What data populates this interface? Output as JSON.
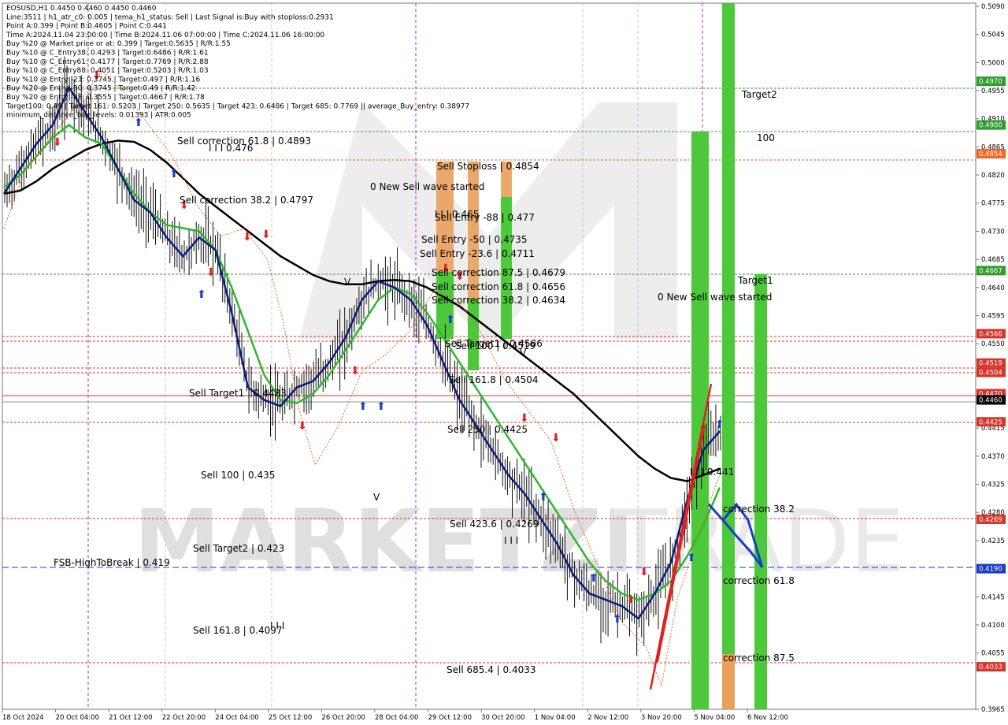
{
  "header": {
    "lines": [
      "EOSUSD,H1  0.4450 0.4460 0.4450 0.4460",
      "Line:3511  | h1_atr_c0: 0.005  | tema_h1_status: Sell  | Last Signal is:Buy with stoploss:0.2931",
      "Point A:0.399  | Point B:0.4605  | Point C:0.441",
      "Time A:2024.11.04 23:00:00  | Time B:2024.11.06 07:00:00  | Time C:2024.11.06 16:00:00",
      "Buy %20 @ Market price or at: 0.399  | Target:0.5635  | R/R:1.55",
      "Buy %10 @ C_Entry38: 0.4293  | Target:0.6486  | R/R:1.61",
      "Buy %10 @ C_Entry61: 0.4177  | Target:0.7769  | R/R:2.88",
      "Buy %10 @ C_Entry88: 0.4051  | Target:0.5203  | R/R:1.03",
      "Buy %10 @ Entry -23: 0.3745  | Target:0.497  | R/R:1.16",
      "Buy %20 @ Entry -50: 0.3745  | Target:0.49  | R/R:1.42",
      "Buy %20 @ Entry -88: 0.3555  | Target:0.4667  | R/R:1.78",
      "Target100: 0.49  | Target 161: 0.5203  | Target 250: 0.5635  | Target 423: 0.6486  | Target 685: 0.7769  || average_Buy_entry: 0.38977",
      "minimum_distance_buy_levels: 0.01393  | ATR:0.005"
    ]
  },
  "watermark": {
    "left": "MARKETZI",
    "right": "TRADE"
  },
  "price_tags": [
    {
      "label": "0.4970",
      "price": 0.497,
      "color": "#2e9d2e"
    },
    {
      "label": "0.4900",
      "price": 0.49,
      "color": "#2e9d2e"
    },
    {
      "label": "0.4854",
      "price": 0.4854,
      "color": "#f26522"
    },
    {
      "label": "0.4667",
      "price": 0.4667,
      "color": "#2e9d2e"
    },
    {
      "label": "0.4566",
      "price": 0.4566,
      "color": "#d9342b"
    },
    {
      "label": "0.4519",
      "price": 0.4519,
      "color": "#d9342b"
    },
    {
      "label": "0.4504",
      "price": 0.4504,
      "color": "#d9342b"
    },
    {
      "label": "0.4470",
      "price": 0.447,
      "color": "#d9342b"
    },
    {
      "label": "0.4460",
      "price": 0.446,
      "color": "#000000"
    },
    {
      "label": "0.4425",
      "price": 0.4425,
      "color": "#d9342b"
    },
    {
      "label": "0.4269",
      "price": 0.4269,
      "color": "#d9342b"
    },
    {
      "label": "0.4190",
      "price": 0.419,
      "color": "#1a3cc8"
    },
    {
      "label": "0.4033",
      "price": 0.4033,
      "color": "#d9342b"
    }
  ],
  "annotations": [
    {
      "text": "Sell correction 61.8 | 0.4893",
      "color": "#1f3f8a"
    },
    {
      "text": "I I I  0.476",
      "color": "#1f3f8a"
    },
    {
      "text": "Sell correction 38.2 | 0.4797",
      "color": "#1f3f8a"
    },
    {
      "text": "0 New Sell wave started",
      "color": "#000000"
    },
    {
      "text": "Sell Stoploss | 0.4854",
      "color": "#f26522"
    },
    {
      "text": "I I I  0.465",
      "color": "#1f3f8a"
    },
    {
      "text": "Sell Entry -88 | 0.477",
      "color": "#2e9d2e"
    },
    {
      "text": "Sell Entry -50 | 0.4735",
      "color": "#2e9d2e"
    },
    {
      "text": "Sell Entry -23.6 | 0.4711",
      "color": "#2e9d2e"
    },
    {
      "text": "Sell correction 87.5 | 0.4679",
      "color": "#1f3f8a"
    },
    {
      "text": "Sell correction 61.8 | 0.4656",
      "color": "#1f3f8a"
    },
    {
      "text": "Sell correction 38.2 | 0.4634",
      "color": "#1f3f8a"
    },
    {
      "text": "Sell Target1 | 0.4566",
      "color": "#d9342b"
    },
    {
      "text": "Sell 100 | 0.4519",
      "color": "#d9342b"
    },
    {
      "text": "Sell 161.8 | 0.4504",
      "color": "#d9342b"
    },
    {
      "text": "Sell Target1 | 0.4483",
      "color": "#d9342b"
    },
    {
      "text": "Sell  250 | 0.4425",
      "color": "#d9342b"
    },
    {
      "text": "Sell 100 | 0.435",
      "color": "#d9342b"
    },
    {
      "text": "Sell  423.6 | 0.4269",
      "color": "#d9342b"
    },
    {
      "text": "I I I",
      "color": "#000000"
    },
    {
      "text": "Sell Target2 | 0.423",
      "color": "#d9342b"
    },
    {
      "text": "FSB-HighToBreak  |  0.419",
      "color": "#000000"
    },
    {
      "text": "Sell 161.8 | 0.4097",
      "color": "#d9342b"
    },
    {
      "text": "I I I",
      "color": "#000000"
    },
    {
      "text": "Sell  685.4 | 0.4033",
      "color": "#d9342b"
    },
    {
      "text": "0 New Sell wave started",
      "color": "#000000"
    },
    {
      "text": "Target2",
      "color": "#2e9d2e"
    },
    {
      "text": "100",
      "color": "#2e9d2e"
    },
    {
      "text": "Target1",
      "color": "#2e9d2e"
    },
    {
      "text": "I I I  0.441",
      "color": "#1a3cc8"
    },
    {
      "text": "correction 38.2",
      "color": "#1a3cc8"
    },
    {
      "text": "correction 61.8",
      "color": "#1a3cc8"
    },
    {
      "text": "correction 87.5",
      "color": "#1a3cc8"
    },
    {
      "text": "V",
      "color": "#000000"
    },
    {
      "text": "V",
      "color": "#000000"
    },
    {
      "text": "V",
      "color": "#000000"
    }
  ],
  "chart_data": {
    "type": "line",
    "symbol": "EOSUSD",
    "timeframe": "H1",
    "ylim": [
      0.3965,
      0.5095
    ],
    "y_ticks": [
      "0.5090",
      "0.5045",
      "0.5000",
      "0.4955",
      "0.4910",
      "0.4865",
      "0.4820",
      "0.4775",
      "0.4730",
      "0.4685",
      "0.4640",
      "0.4595",
      "0.4550",
      "0.4505",
      "0.4415",
      "0.4370",
      "0.4325",
      "0.4280",
      "0.4235",
      "0.4145",
      "0.4100",
      "0.4055",
      "0.3965"
    ],
    "x_ticks": [
      "18 Oct 2024",
      "20 Oct 04:00",
      "21 Oct 12:00",
      "22 Oct 20:00",
      "24 Oct 04:00",
      "25 Oct 12:00",
      "26 Oct 20:00",
      "28 Oct 04:00",
      "29 Oct 12:00",
      "30 Oct 20:00",
      "1 Nov 04:00",
      "2 Nov 12:00",
      "3 Nov 20:00",
      "5 Nov 04:00",
      "6 Nov 12:00"
    ],
    "grid": false,
    "series": [
      {
        "color": "#000000",
        "values": [
          0.479,
          0.4795,
          0.481,
          0.483,
          0.4845,
          0.486,
          0.487,
          0.4875,
          0.4873,
          0.486,
          0.484,
          0.4815,
          0.479,
          0.477,
          0.475,
          0.473,
          0.471,
          0.469,
          0.4675,
          0.466,
          0.465,
          0.4645,
          0.4645,
          0.465,
          0.4652,
          0.465,
          0.464,
          0.4625,
          0.461,
          0.459,
          0.457,
          0.455,
          0.453,
          0.451,
          0.449,
          0.447,
          0.4445,
          0.442,
          0.4395,
          0.437,
          0.435,
          0.4335,
          0.433,
          0.434,
          0.435
        ]
      },
      {
        "color": "#2db82d",
        "values": [
          0.48,
          0.482,
          0.485,
          0.488,
          0.49,
          0.488,
          0.487,
          0.483,
          0.479,
          0.476,
          0.474,
          0.4735,
          0.473,
          0.47,
          0.464,
          0.457,
          0.45,
          0.446,
          0.4455,
          0.447,
          0.45,
          0.454,
          0.458,
          0.462,
          0.464,
          0.463,
          0.46,
          0.456,
          0.452,
          0.448,
          0.444,
          0.44,
          0.436,
          0.432,
          0.428,
          0.424,
          0.42,
          0.417,
          0.415,
          0.414,
          0.415,
          0.417,
          0.421,
          0.426,
          0.432
        ]
      },
      {
        "color": "#0b1a7a",
        "values": [
          0.479,
          0.483,
          0.487,
          0.49,
          0.496,
          0.492,
          0.488,
          0.483,
          0.478,
          0.476,
          0.472,
          0.469,
          0.472,
          0.47,
          0.46,
          0.448,
          0.446,
          0.445,
          0.448,
          0.449,
          0.452,
          0.456,
          0.462,
          0.465,
          0.464,
          0.462,
          0.458,
          0.452,
          0.446,
          0.442,
          0.438,
          0.434,
          0.431,
          0.427,
          0.423,
          0.418,
          0.415,
          0.414,
          0.413,
          0.411,
          0.415,
          0.42,
          0.43,
          0.438,
          0.441
        ]
      }
    ]
  }
}
